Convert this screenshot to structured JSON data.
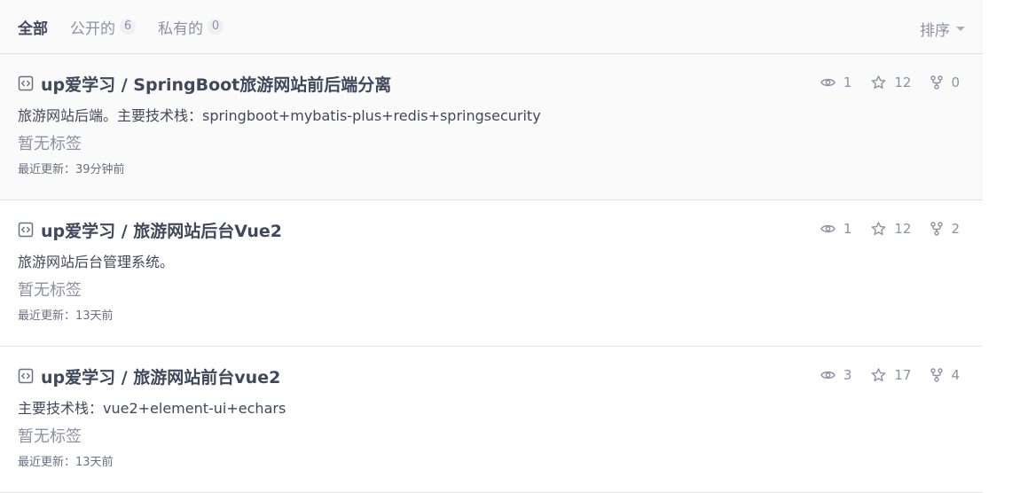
{
  "tabs": [
    {
      "label": "全部",
      "count": null,
      "active": true
    },
    {
      "label": "公开的",
      "count": "6"
    },
    {
      "label": "私有的",
      "count": "0"
    }
  ],
  "sort": {
    "label": "排序"
  },
  "repos": [
    {
      "title": "up爱学习 / SpringBoot旅游网站前后端分离",
      "description": "旅游网站后端。主要技术栈：springboot+mybatis-plus+redis+springsecurity",
      "tags": "暂无标签",
      "updated_label": "最近更新：",
      "updated": "39分钟前",
      "watches": "1",
      "stars": "12",
      "forks": "0"
    },
    {
      "title": "up爱学习 / 旅游网站后台Vue2",
      "description": "旅游网站后台管理系统。",
      "tags": "暂无标签",
      "updated_label": "最近更新：",
      "updated": "13天前",
      "watches": "1",
      "stars": "12",
      "forks": "2"
    },
    {
      "title": "up爱学习 / 旅游网站前台vue2",
      "description": "主要技术栈：vue2+element-ui+echars",
      "tags": "暂无标签",
      "updated_label": "最近更新：",
      "updated": "13天前",
      "watches": "3",
      "stars": "17",
      "forks": "4"
    }
  ],
  "colors": {
    "text": "#40485b",
    "muted": "#8c92a4",
    "border": "#e3e3e3",
    "hover_bg": "#fafafa"
  }
}
